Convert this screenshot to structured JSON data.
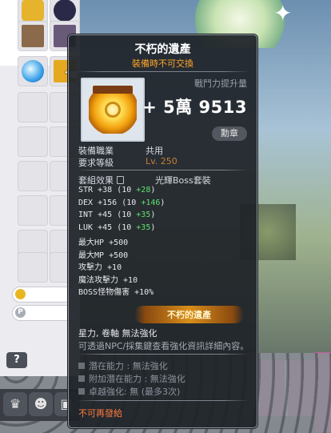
{
  "tooltip": {
    "title": "不朽的遺產",
    "subtitle": "裝備時不可交換",
    "cp_label": "戰鬥力提升量",
    "cp_value": "+ 5萬 9513",
    "badge": "勳章",
    "job_label": "裝備職業",
    "job_value": "共用",
    "level_label": "要求等級",
    "level_value": "Lv. 250",
    "set_label": "套組效果",
    "set_name": "光輝Boss套裝",
    "stats": [
      {
        "name": "STR",
        "base": "+38",
        "detail": "(10 ",
        "bonus": "+28",
        "tail": ")"
      },
      {
        "name": "DEX",
        "base": "+156",
        "detail": "(10 ",
        "bonus": "+146",
        "tail": ")"
      },
      {
        "name": "INT",
        "base": "+45",
        "detail": "(10 ",
        "bonus": "+35",
        "tail": ")"
      },
      {
        "name": "LUK",
        "base": "+45",
        "detail": "(10 ",
        "bonus": "+35",
        "tail": ")"
      },
      {
        "name": "最大HP",
        "base": "+500",
        "detail": "",
        "bonus": "",
        "tail": ""
      },
      {
        "name": "最大MP",
        "base": "+500",
        "detail": "",
        "bonus": "",
        "tail": ""
      },
      {
        "name": "攻擊力",
        "base": "+10",
        "detail": "",
        "bonus": "",
        "tail": ""
      },
      {
        "name": "魔法攻擊力",
        "base": "+10",
        "detail": "",
        "bonus": "",
        "tail": ""
      },
      {
        "name": "BOSS怪物傷害",
        "base": "+10%",
        "detail": "",
        "bonus": "",
        "tail": ""
      }
    ],
    "banner": "不朽的遺產",
    "note1": "星力, 卷軸 無法強化",
    "note2": "可透過NPC/採集鍵查看強化資訊詳細內容。",
    "potentials": [
      "潛在能力 : 無法強化",
      "附加潛在能力 : 無法強化",
      "卓越強化: 無 (最多3次)"
    ],
    "footer": "不可再發給"
  },
  "inventory": {
    "help": "?"
  },
  "colors": {
    "tooltip_bg": "#1e2228",
    "subtitle": "#ffa728",
    "bonus_green": "#5fe070",
    "level": "#c77d3a",
    "footer": "#ff7b3c"
  }
}
